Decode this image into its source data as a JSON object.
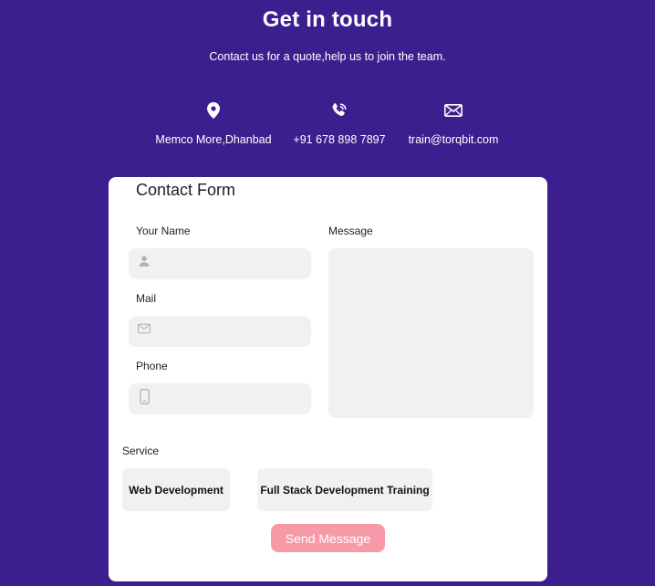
{
  "header": {
    "title": "Get in touch",
    "subtitle": "Contact us for a quote,help us to join the team."
  },
  "contacts": {
    "address": {
      "icon": "location-pin-icon",
      "text": "Memco More,Dhanbad"
    },
    "phone": {
      "icon": "phone-call-icon",
      "text": "+91 678 898 7897"
    },
    "email": {
      "icon": "envelope-icon",
      "text": "train@torqbit.com"
    }
  },
  "form": {
    "title": "Contact Form",
    "name_label": "Your Name",
    "name_icon": "user-icon",
    "name_value": "",
    "mail_label": "Mail",
    "mail_icon": "envelope-icon",
    "mail_value": "",
    "phone_label": "Phone",
    "phone_icon": "mobile-phone-icon",
    "phone_value": "",
    "message_label": "Message",
    "message_value": "",
    "service_label": "Service",
    "services": [
      "Web Development",
      "Full Stack Development Training"
    ],
    "send_label": "Send Message"
  },
  "colors": {
    "background": "#3c1f8f",
    "card": "#ffffff",
    "field": "#f1f1f1",
    "send_button": "#f79aa8"
  }
}
